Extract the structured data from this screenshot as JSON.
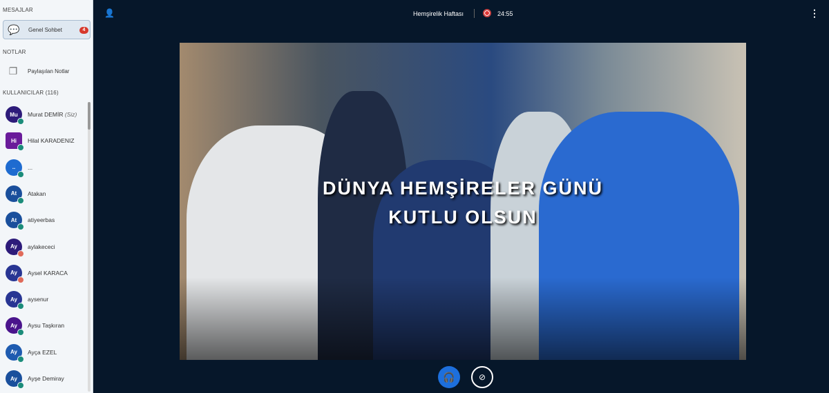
{
  "sidebar": {
    "messages_title": "MESAJLAR",
    "chat": {
      "label": "Genel Sohbet",
      "badge": "4"
    },
    "notes_title": "NOTLAR",
    "notes": {
      "label": "Paylaşılan Notlar"
    },
    "users_title": "KULLANICILAR (116)",
    "users": [
      {
        "initials": "Mu",
        "name": "Murat DEMİR",
        "suffix": "(Siz)",
        "color": "#2d1b7a",
        "status": "#1b8c7a"
      },
      {
        "initials": "Hi",
        "name": "Hilal KARADENIZ",
        "suffix": "",
        "color": "#6a1b9a",
        "status": "#1b8c7a"
      },
      {
        "initials": "..",
        "name": "...",
        "suffix": "",
        "color": "#1e6bd0",
        "status": "#1b8c7a"
      },
      {
        "initials": "At",
        "name": "Atakan",
        "suffix": "",
        "color": "#1a4f9c",
        "status": "#1b8c7a"
      },
      {
        "initials": "At",
        "name": "atiyeerbas",
        "suffix": "",
        "color": "#1a4f9c",
        "status": "#1b8c7a"
      },
      {
        "initials": "Ay",
        "name": "aylakececi",
        "suffix": "",
        "color": "#2d1b7a",
        "status": "#e06a5a"
      },
      {
        "initials": "Ay",
        "name": "Aysel KARACA",
        "suffix": "",
        "color": "#283593",
        "status": "#e06a5a"
      },
      {
        "initials": "Ay",
        "name": "aysenur",
        "suffix": "",
        "color": "#283593",
        "status": "#1b8c7a"
      },
      {
        "initials": "Ay",
        "name": "Aysu Taşkıran",
        "suffix": "",
        "color": "#4a148c",
        "status": "#1b8c7a"
      },
      {
        "initials": "Ay",
        "name": "Ayça EZEL",
        "suffix": "",
        "color": "#1e5bb0",
        "status": "#1b8c7a"
      },
      {
        "initials": "Ay",
        "name": "Ayşe Demiray",
        "suffix": "",
        "color": "#1a4f9c",
        "status": "#1b8c7a"
      }
    ]
  },
  "header": {
    "title": "Hemşirelik Haftası",
    "timer": "24:55"
  },
  "video": {
    "line1": "DÜNYA HEMŞİRELER GÜNÜ",
    "line2": "KUTLU OLSUN"
  },
  "icons": {
    "user": "user-icon",
    "options": "more-vertical-icon",
    "audio": "headphones-icon",
    "camera": "camera-off-icon"
  }
}
